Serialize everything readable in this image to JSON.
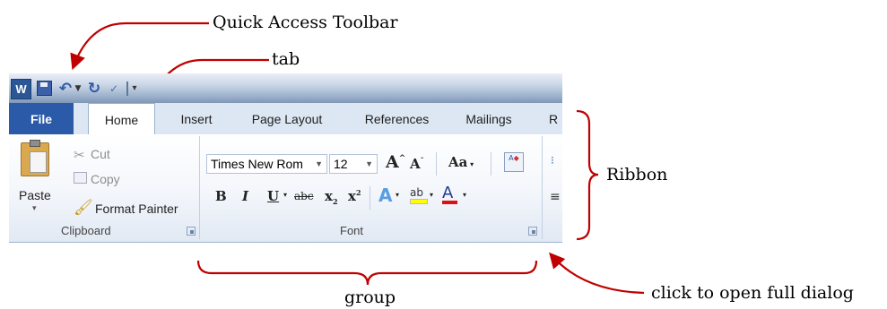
{
  "annotations": {
    "quick_access": "Quick Access Toolbar",
    "tab": "tab",
    "ribbon": "Ribbon",
    "group": "group",
    "dialog": "click to open full dialog"
  },
  "quick_access_toolbar": {
    "app_icon": "W",
    "icons": [
      "save-icon",
      "undo-icon",
      "redo-icon",
      "spelling-icon",
      "customize-toolbar-icon"
    ]
  },
  "tabs": [
    "File",
    "Home",
    "Insert",
    "Page Layout",
    "References",
    "Mailings",
    "R"
  ],
  "clipboard": {
    "paste": "Paste",
    "cut": "Cut",
    "copy": "Copy",
    "format_painter": "Format Painter",
    "label": "Clipboard"
  },
  "font": {
    "font_name": "Times New Rom",
    "font_size": "12",
    "grow": "A",
    "shrink": "A",
    "change_case": "Aa",
    "bold": "B",
    "italic": "I",
    "underline": "U",
    "strikethrough": "abc",
    "subscript": "x",
    "superscript": "x",
    "text_effects": "A",
    "highlight": "ab",
    "font_color": "A",
    "label": "Font"
  },
  "colors": {
    "annotation_arrow": "#c00000",
    "file_tab": "#2a5aa8",
    "font_color_bar": "#e01010",
    "highlight_bar": "#ffff00"
  }
}
